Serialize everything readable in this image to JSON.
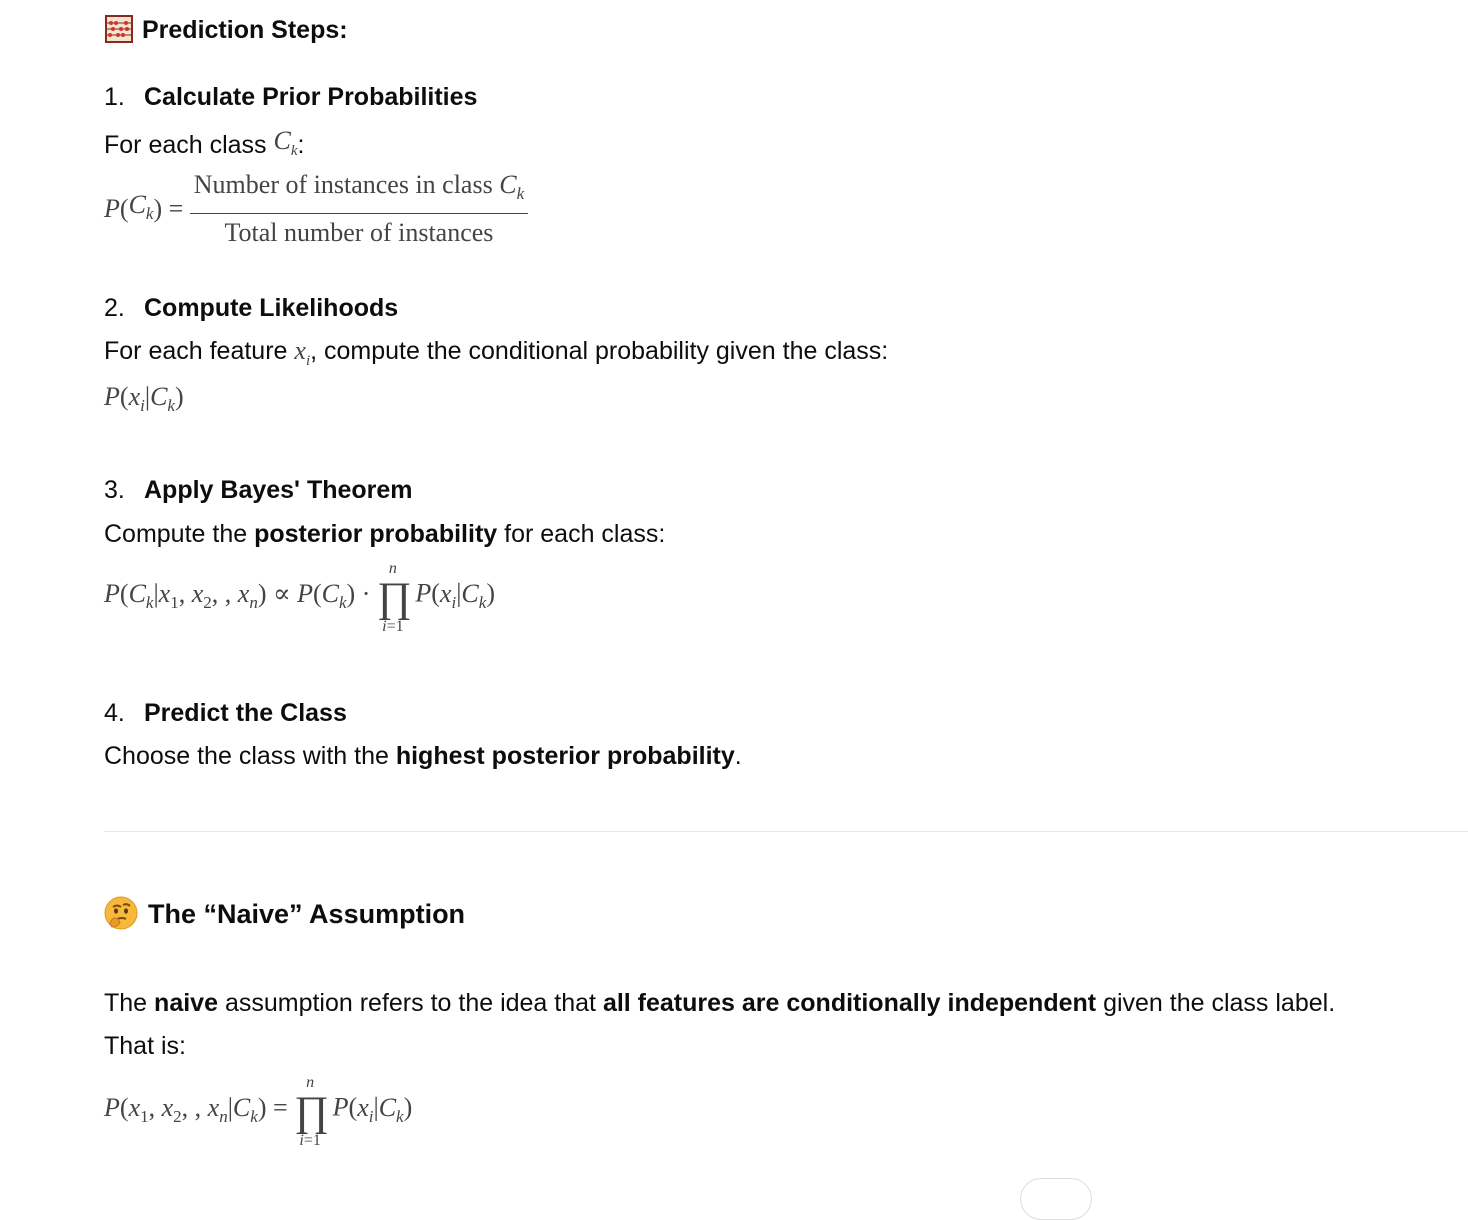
{
  "prediction_steps": {
    "title": "Prediction Steps:",
    "icon": "abacus-icon"
  },
  "steps": [
    {
      "number": "1.",
      "title": "Calculate Prior Probabilities",
      "text_before": "For each class",
      "text_after": ":",
      "fraction_numerator": "Number of instances in class",
      "fraction_denominator": "Total number of instances"
    },
    {
      "number": "2.",
      "title": "Compute Likelihoods",
      "text_before": "For each feature",
      "text_after": ", compute the conditional probability given the class:"
    },
    {
      "number": "3.",
      "title": "Apply Bayes' Theorem",
      "text_before": "Compute the",
      "bold": "posterior probability",
      "text_after": "for each class:"
    },
    {
      "number": "4.",
      "title": "Predict the Class",
      "text_before": "Choose the class with the",
      "bold": "highest posterior probability",
      "text_after": "."
    }
  ],
  "naive": {
    "icon": "thinking-face-icon",
    "title": "The “Naive” Assumption",
    "p1": "The",
    "p1_bold": "naive",
    "p2": "assumption refers to the idea that",
    "p2_bold": "all features are conditionally independent",
    "p3": "given the class label.",
    "line2": "That is:"
  }
}
